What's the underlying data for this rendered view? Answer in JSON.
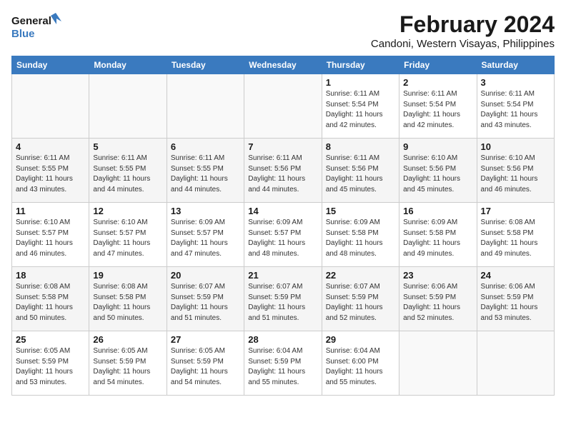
{
  "header": {
    "logo_line1": "General",
    "logo_line2": "Blue",
    "month_year": "February 2024",
    "location": "Candoni, Western Visayas, Philippines"
  },
  "calendar": {
    "days_of_week": [
      "Sunday",
      "Monday",
      "Tuesday",
      "Wednesday",
      "Thursday",
      "Friday",
      "Saturday"
    ],
    "weeks": [
      [
        {
          "day": "",
          "info": ""
        },
        {
          "day": "",
          "info": ""
        },
        {
          "day": "",
          "info": ""
        },
        {
          "day": "",
          "info": ""
        },
        {
          "day": "1",
          "info": "Sunrise: 6:11 AM\nSunset: 5:54 PM\nDaylight: 11 hours\nand 42 minutes."
        },
        {
          "day": "2",
          "info": "Sunrise: 6:11 AM\nSunset: 5:54 PM\nDaylight: 11 hours\nand 42 minutes."
        },
        {
          "day": "3",
          "info": "Sunrise: 6:11 AM\nSunset: 5:54 PM\nDaylight: 11 hours\nand 43 minutes."
        }
      ],
      [
        {
          "day": "4",
          "info": "Sunrise: 6:11 AM\nSunset: 5:55 PM\nDaylight: 11 hours\nand 43 minutes."
        },
        {
          "day": "5",
          "info": "Sunrise: 6:11 AM\nSunset: 5:55 PM\nDaylight: 11 hours\nand 44 minutes."
        },
        {
          "day": "6",
          "info": "Sunrise: 6:11 AM\nSunset: 5:55 PM\nDaylight: 11 hours\nand 44 minutes."
        },
        {
          "day": "7",
          "info": "Sunrise: 6:11 AM\nSunset: 5:56 PM\nDaylight: 11 hours\nand 44 minutes."
        },
        {
          "day": "8",
          "info": "Sunrise: 6:11 AM\nSunset: 5:56 PM\nDaylight: 11 hours\nand 45 minutes."
        },
        {
          "day": "9",
          "info": "Sunrise: 6:10 AM\nSunset: 5:56 PM\nDaylight: 11 hours\nand 45 minutes."
        },
        {
          "day": "10",
          "info": "Sunrise: 6:10 AM\nSunset: 5:56 PM\nDaylight: 11 hours\nand 46 minutes."
        }
      ],
      [
        {
          "day": "11",
          "info": "Sunrise: 6:10 AM\nSunset: 5:57 PM\nDaylight: 11 hours\nand 46 minutes."
        },
        {
          "day": "12",
          "info": "Sunrise: 6:10 AM\nSunset: 5:57 PM\nDaylight: 11 hours\nand 47 minutes."
        },
        {
          "day": "13",
          "info": "Sunrise: 6:09 AM\nSunset: 5:57 PM\nDaylight: 11 hours\nand 47 minutes."
        },
        {
          "day": "14",
          "info": "Sunrise: 6:09 AM\nSunset: 5:57 PM\nDaylight: 11 hours\nand 48 minutes."
        },
        {
          "day": "15",
          "info": "Sunrise: 6:09 AM\nSunset: 5:58 PM\nDaylight: 11 hours\nand 48 minutes."
        },
        {
          "day": "16",
          "info": "Sunrise: 6:09 AM\nSunset: 5:58 PM\nDaylight: 11 hours\nand 49 minutes."
        },
        {
          "day": "17",
          "info": "Sunrise: 6:08 AM\nSunset: 5:58 PM\nDaylight: 11 hours\nand 49 minutes."
        }
      ],
      [
        {
          "day": "18",
          "info": "Sunrise: 6:08 AM\nSunset: 5:58 PM\nDaylight: 11 hours\nand 50 minutes."
        },
        {
          "day": "19",
          "info": "Sunrise: 6:08 AM\nSunset: 5:58 PM\nDaylight: 11 hours\nand 50 minutes."
        },
        {
          "day": "20",
          "info": "Sunrise: 6:07 AM\nSunset: 5:59 PM\nDaylight: 11 hours\nand 51 minutes."
        },
        {
          "day": "21",
          "info": "Sunrise: 6:07 AM\nSunset: 5:59 PM\nDaylight: 11 hours\nand 51 minutes."
        },
        {
          "day": "22",
          "info": "Sunrise: 6:07 AM\nSunset: 5:59 PM\nDaylight: 11 hours\nand 52 minutes."
        },
        {
          "day": "23",
          "info": "Sunrise: 6:06 AM\nSunset: 5:59 PM\nDaylight: 11 hours\nand 52 minutes."
        },
        {
          "day": "24",
          "info": "Sunrise: 6:06 AM\nSunset: 5:59 PM\nDaylight: 11 hours\nand 53 minutes."
        }
      ],
      [
        {
          "day": "25",
          "info": "Sunrise: 6:05 AM\nSunset: 5:59 PM\nDaylight: 11 hours\nand 53 minutes."
        },
        {
          "day": "26",
          "info": "Sunrise: 6:05 AM\nSunset: 5:59 PM\nDaylight: 11 hours\nand 54 minutes."
        },
        {
          "day": "27",
          "info": "Sunrise: 6:05 AM\nSunset: 5:59 PM\nDaylight: 11 hours\nand 54 minutes."
        },
        {
          "day": "28",
          "info": "Sunrise: 6:04 AM\nSunset: 5:59 PM\nDaylight: 11 hours\nand 55 minutes."
        },
        {
          "day": "29",
          "info": "Sunrise: 6:04 AM\nSunset: 6:00 PM\nDaylight: 11 hours\nand 55 minutes."
        },
        {
          "day": "",
          "info": ""
        },
        {
          "day": "",
          "info": ""
        }
      ]
    ]
  }
}
